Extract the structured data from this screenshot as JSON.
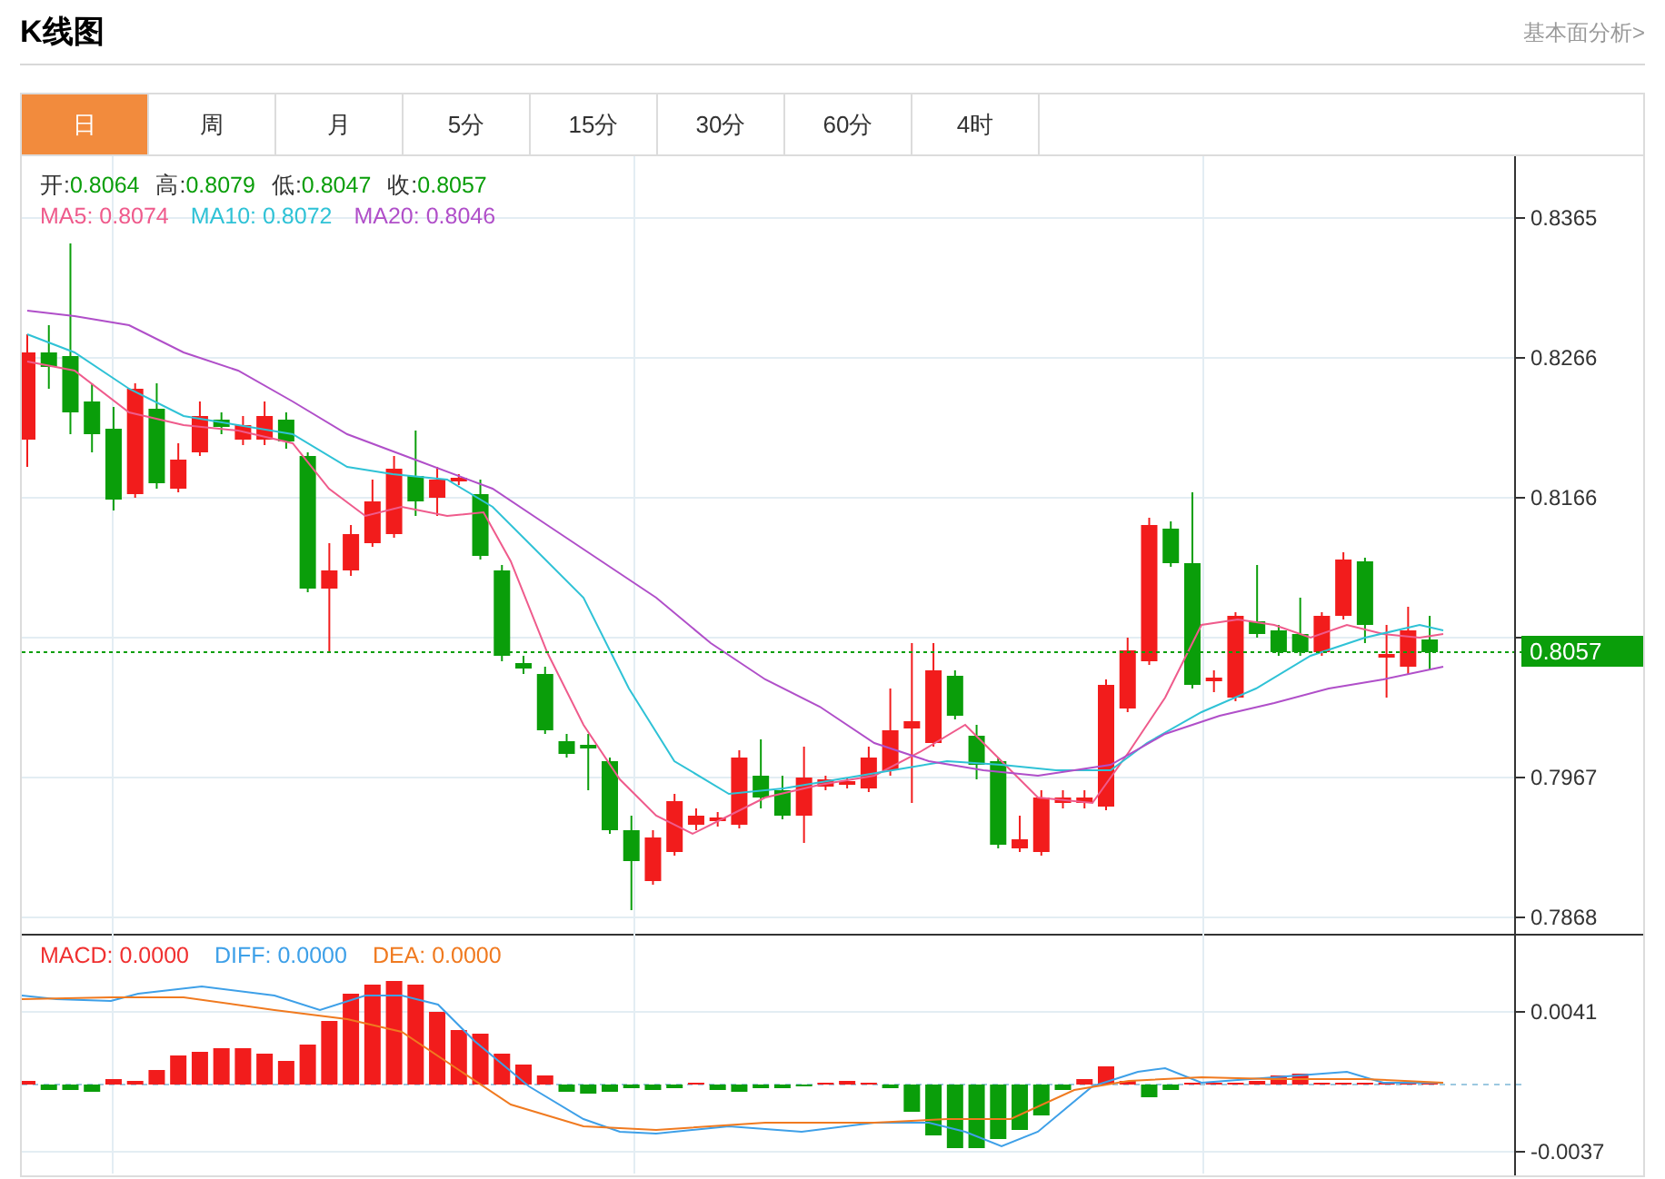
{
  "header": {
    "title": "K线图",
    "link": "基本面分析>"
  },
  "tabs": [
    {
      "label": "日",
      "selected": true
    },
    {
      "label": "周",
      "selected": false
    },
    {
      "label": "月",
      "selected": false
    },
    {
      "label": "5分",
      "selected": false
    },
    {
      "label": "15分",
      "selected": false
    },
    {
      "label": "30分",
      "selected": false
    },
    {
      "label": "60分",
      "selected": false
    },
    {
      "label": "4时",
      "selected": false
    }
  ],
  "ohlc": [
    {
      "label": "开:",
      "value": "0.8064"
    },
    {
      "label": "高:",
      "value": "0.8079"
    },
    {
      "label": "低:",
      "value": "0.8047"
    },
    {
      "label": "收:",
      "value": "0.8057"
    }
  ],
  "moving_averages": [
    {
      "text": "MA5: 0.8074",
      "color": "#ef5b8c"
    },
    {
      "text": "MA10: 0.8072",
      "color": "#2fc2d6"
    },
    {
      "text": "MA20: 0.8046",
      "color": "#b04fc9"
    }
  ],
  "price_axis": [
    "0.8365",
    "0.8266",
    "0.8166",
    "0.7967",
    "0.7868"
  ],
  "current_price": "0.8057",
  "macd_legend": [
    {
      "text": "MACD: 0.0000",
      "color": "#f03030"
    },
    {
      "text": "DIFF: 0.0000",
      "color": "#3ea0e8"
    },
    {
      "text": "DEA: 0.0000",
      "color": "#f07a20"
    }
  ],
  "macd_axis": [
    "0.0041",
    "-0.0037"
  ]
}
